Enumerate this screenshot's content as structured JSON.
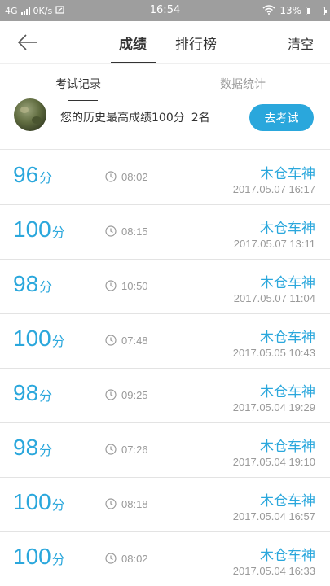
{
  "status_bar": {
    "network": "4G",
    "speed": "0K/s",
    "time": "16:54",
    "battery": "13%",
    "battery_level": 0.13
  },
  "header": {
    "tabs": [
      {
        "label": "成绩",
        "active": true
      },
      {
        "label": "排行榜",
        "active": false
      }
    ],
    "clear_label": "清空"
  },
  "subtabs": [
    {
      "label": "考试记录",
      "active": true
    },
    {
      "label": "数据统计",
      "active": false
    }
  ],
  "summary": {
    "text": "您的历史最高成绩100分",
    "rank": "2名",
    "exam_button": "去考试"
  },
  "records": [
    {
      "score": "96",
      "unit": "分",
      "duration": "08:02",
      "name": "木仓车神",
      "datetime": "2017.05.07  16:17"
    },
    {
      "score": "100",
      "unit": "分",
      "duration": "08:15",
      "name": "木仓车神",
      "datetime": "2017.05.07  13:11"
    },
    {
      "score": "98",
      "unit": "分",
      "duration": "10:50",
      "name": "木仓车神",
      "datetime": "2017.05.07  11:04"
    },
    {
      "score": "100",
      "unit": "分",
      "duration": "07:48",
      "name": "木仓车神",
      "datetime": "2017.05.05  10:43"
    },
    {
      "score": "98",
      "unit": "分",
      "duration": "09:25",
      "name": "木仓车神",
      "datetime": "2017.05.04  19:29"
    },
    {
      "score": "98",
      "unit": "分",
      "duration": "07:26",
      "name": "木仓车神",
      "datetime": "2017.05.04  19:10"
    },
    {
      "score": "100",
      "unit": "分",
      "duration": "08:18",
      "name": "木仓车神",
      "datetime": "2017.05.04  16:57"
    },
    {
      "score": "100",
      "unit": "分",
      "duration": "08:02",
      "name": "木仓车神",
      "datetime": "2017.05.04  16:33"
    }
  ],
  "colors": {
    "accent": "#2aa7dc",
    "status_bar": "#9e9e9e"
  }
}
